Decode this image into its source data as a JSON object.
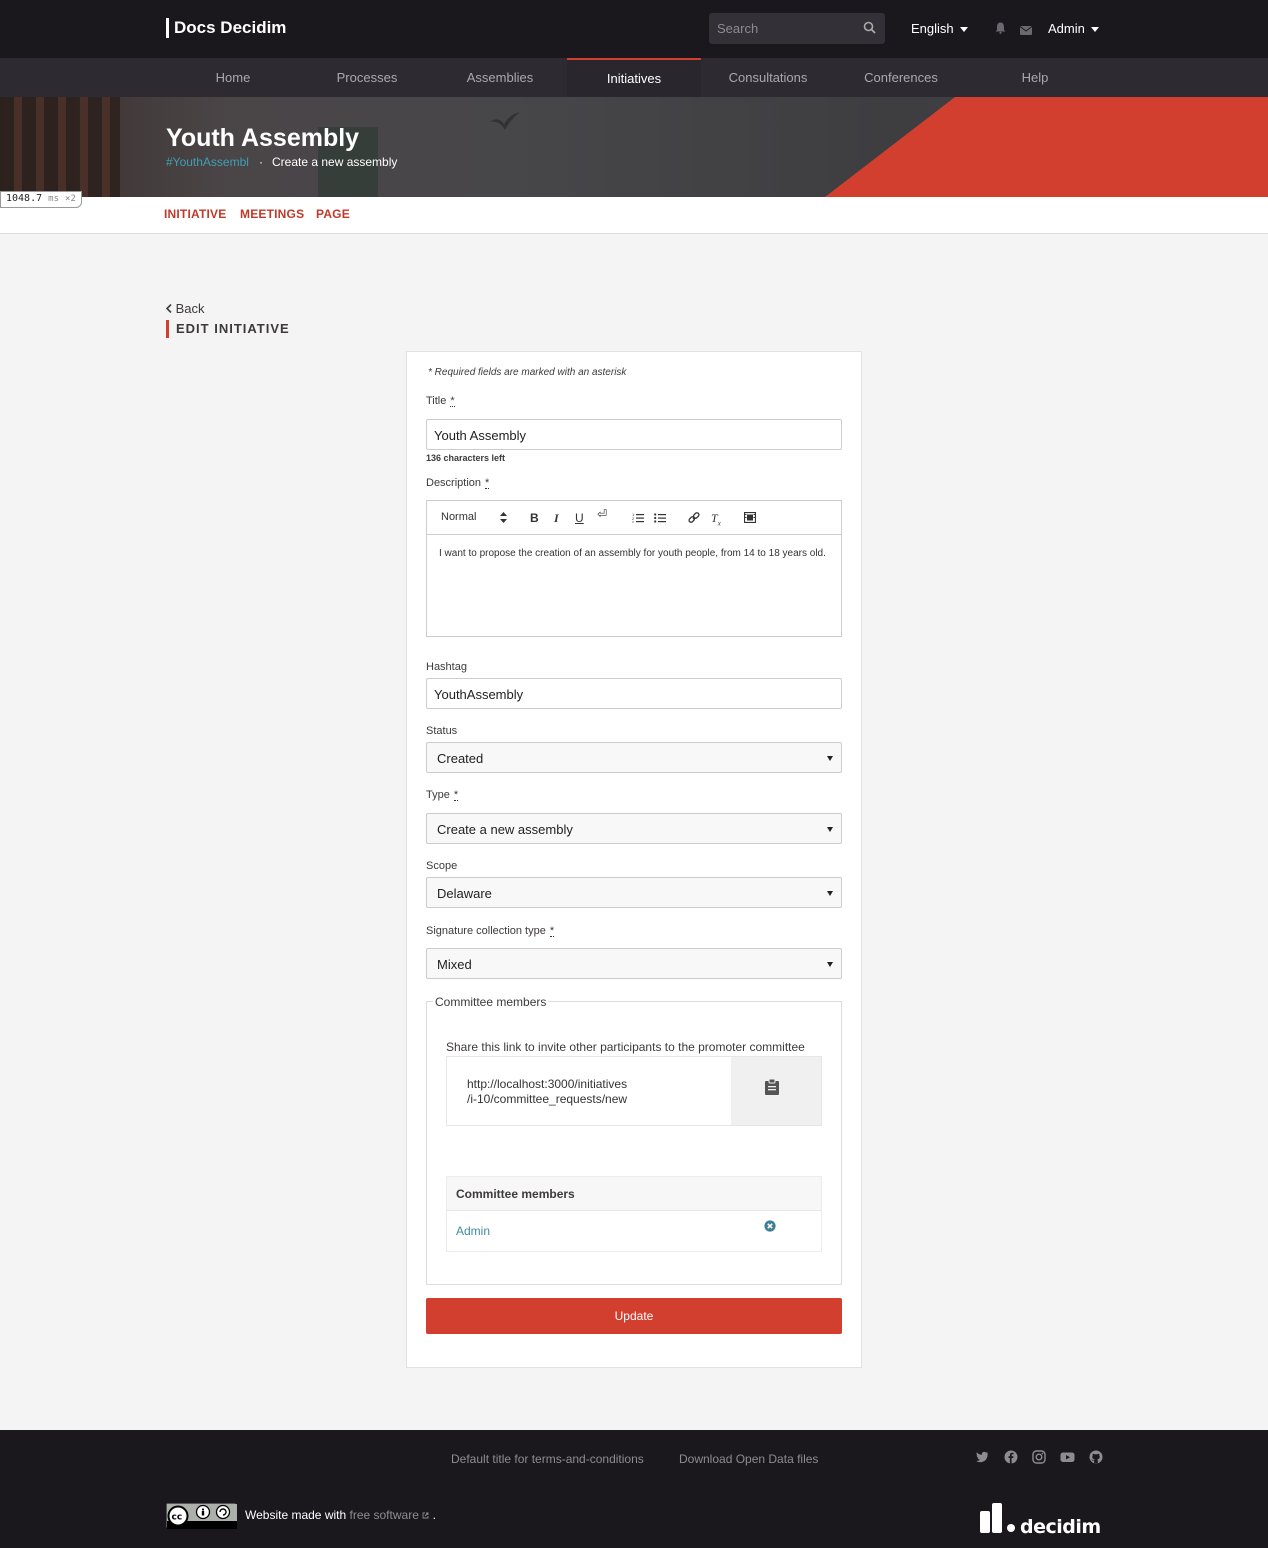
{
  "header": {
    "brand": "Docs Decidim",
    "search_placeholder": "Search",
    "language": "English",
    "user": "Admin"
  },
  "main_nav": {
    "items": [
      "Home",
      "Processes",
      "Assemblies",
      "Initiatives",
      "Consultations",
      "Conferences",
      "Help"
    ],
    "active": "Initiatives"
  },
  "hero": {
    "title": "Youth Assembly",
    "hashtag": "#YouthAssembl",
    "separator": "·",
    "subtitle": "Create a new assembly"
  },
  "timer": {
    "value": "1048.7",
    "unit": "ms",
    "multiplier": "×2"
  },
  "sub_nav": {
    "items": [
      "INITIATIVE",
      "MEETINGS",
      "PAGE"
    ]
  },
  "page": {
    "back": "Back",
    "title": "EDIT INITIATIVE"
  },
  "form": {
    "required_note": "* Required fields are marked with an asterisk",
    "asterisk": "*",
    "title_label": "Title",
    "title_value": "Youth Assembly",
    "chars_left": "136 characters left",
    "description_label": "Description",
    "editor_format": "Normal",
    "description_value": "I want to propose the creation of an assembly for youth people, from 14 to 18 years old.",
    "hashtag_label": "Hashtag",
    "hashtag_value": "YouthAssembly",
    "status_label": "Status",
    "status_value": "Created",
    "type_label": "Type",
    "type_value": "Create a new assembly",
    "scope_label": "Scope",
    "scope_value": "Delaware",
    "signature_label": "Signature collection type",
    "signature_value": "Mixed",
    "committee_legend": "Committee members",
    "share_text": "Share this link to invite other participants to the promoter committee",
    "link_line1": "http://localhost:3000/initiatives",
    "link_line2": "/i-10/committee_requests/new",
    "members_header": "Committee members",
    "member_name": "Admin",
    "submit": "Update"
  },
  "footer": {
    "terms": "Default title for terms-and-conditions",
    "open_data": "Download Open Data files",
    "made_with": "Website made with",
    "free_software": "free software",
    "period": ".",
    "logo_text": "decidim"
  },
  "colors": {
    "accent": "#d23f2f",
    "dark": "#1a181d",
    "link": "#3f8aa3"
  }
}
